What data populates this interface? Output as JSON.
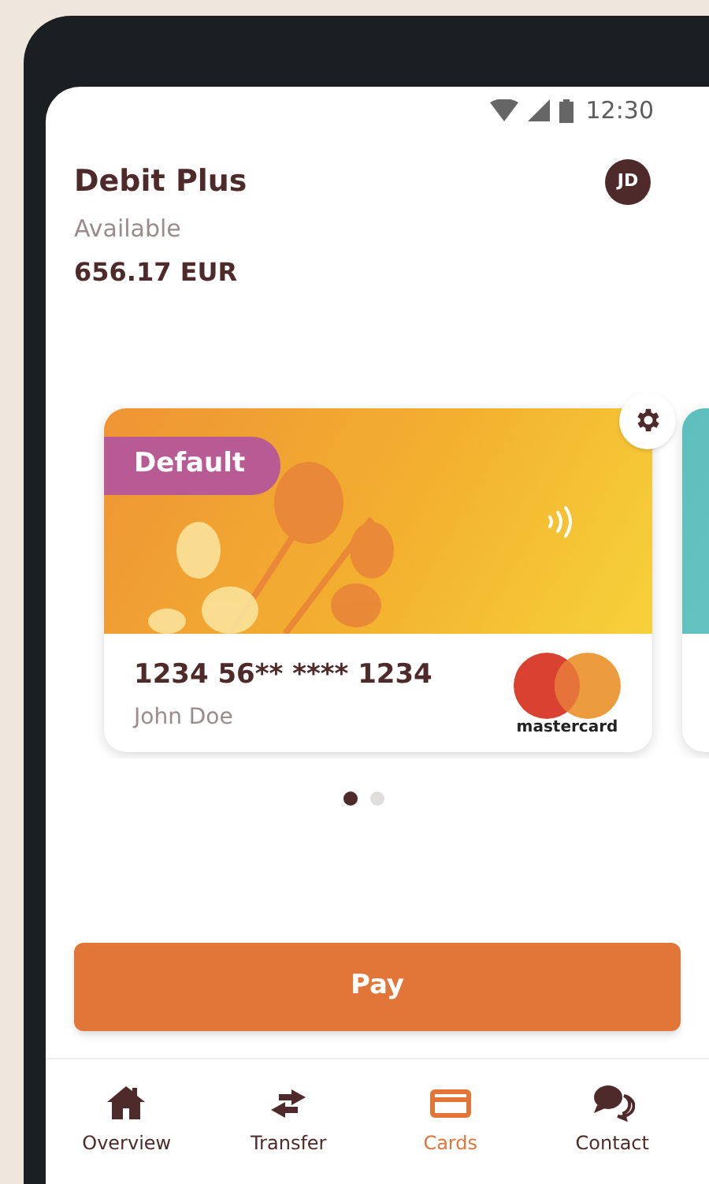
{
  "status_bar": {
    "time": "12:30"
  },
  "header": {
    "title": "Debit Plus",
    "avatar_initials": "JD",
    "balance_label": "Available",
    "balance": "656.17 EUR"
  },
  "cards": [
    {
      "badge": "Default",
      "number": "1234 56** **** 1234",
      "holder": "John Doe",
      "brand": "mastercard",
      "kind": "autumn"
    },
    {
      "kind": "teal"
    }
  ],
  "pager": [
    {
      "selected": true
    },
    {
      "selected": false
    }
  ],
  "pay_button": "Pay",
  "nav": [
    {
      "label": "Overview",
      "kind": "home",
      "selected": false
    },
    {
      "label": "Transfer",
      "kind": "transfer",
      "selected": false
    },
    {
      "label": "Cards",
      "kind": "card",
      "selected": true
    },
    {
      "label": "Contact",
      "kind": "chat",
      "selected": false
    }
  ]
}
